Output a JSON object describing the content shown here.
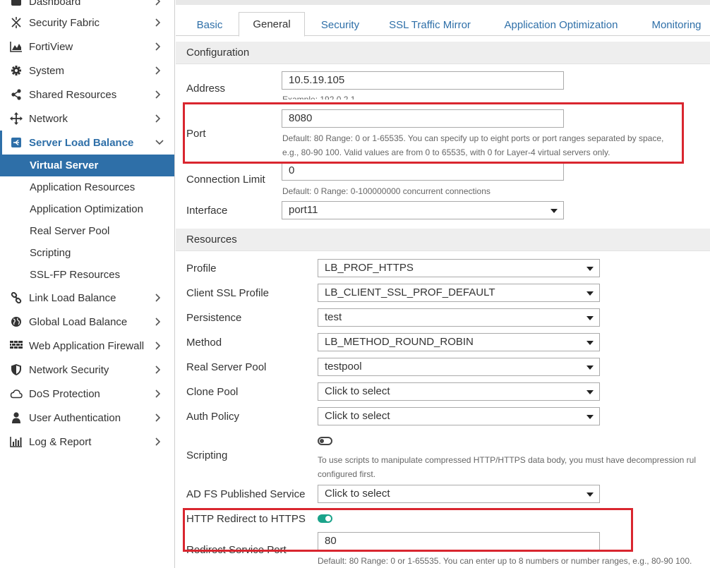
{
  "sidebar": {
    "items": [
      {
        "label": "Dashboard"
      },
      {
        "label": "Security Fabric"
      },
      {
        "label": "FortiView"
      },
      {
        "label": "System"
      },
      {
        "label": "Shared Resources"
      },
      {
        "label": "Network"
      },
      {
        "label": "Server Load Balance"
      },
      {
        "label": "Link Load Balance"
      },
      {
        "label": "Global Load Balance"
      },
      {
        "label": "Web Application Firewall"
      },
      {
        "label": "Network Security"
      },
      {
        "label": "DoS Protection"
      },
      {
        "label": "User Authentication"
      },
      {
        "label": "Log & Report"
      }
    ],
    "sub_items": [
      {
        "label": "Virtual Server"
      },
      {
        "label": "Application Resources"
      },
      {
        "label": "Application Optimization"
      },
      {
        "label": "Real Server Pool"
      },
      {
        "label": "Scripting"
      },
      {
        "label": "SSL-FP Resources"
      }
    ],
    "accent_color": "#2e6fa8"
  },
  "tabs": [
    {
      "label": "Basic"
    },
    {
      "label": "General"
    },
    {
      "label": "Security"
    },
    {
      "label": "SSL Traffic Mirror"
    },
    {
      "label": "Application Optimization"
    },
    {
      "label": "Monitoring"
    }
  ],
  "configuration": {
    "title": "Configuration",
    "address": {
      "label": "Address",
      "value": "10.5.19.105",
      "hint": "Example: 192.0.2.1"
    },
    "port": {
      "label": "Port",
      "value": "8080",
      "hint_line1": "Default: 80 Range: 0 or 1-65535. You can specify up to eight ports or port ranges separated by space,",
      "hint_line2": "e.g., 80-90 100. Valid values are from 0 to 65535, with 0 for Layer-4 virtual servers only."
    },
    "connection_limit": {
      "label": "Connection Limit",
      "value": "0",
      "hint": "Default: 0 Range: 0-100000000 concurrent connections"
    },
    "interface": {
      "label": "Interface",
      "value": "port11"
    }
  },
  "resources": {
    "title": "Resources",
    "profile": {
      "label": "Profile",
      "value": "LB_PROF_HTTPS"
    },
    "client_ssl_profile": {
      "label": "Client SSL Profile",
      "value": "LB_CLIENT_SSL_PROF_DEFAULT"
    },
    "persistence": {
      "label": "Persistence",
      "value": "test"
    },
    "method": {
      "label": "Method",
      "value": "LB_METHOD_ROUND_ROBIN"
    },
    "real_server_pool": {
      "label": "Real Server Pool",
      "value": "testpool"
    },
    "clone_pool": {
      "label": "Clone Pool",
      "value": "Click to select"
    },
    "auth_policy": {
      "label": "Auth Policy",
      "value": "Click to select"
    },
    "scripting": {
      "label": "Scripting",
      "enabled": false,
      "hint_line1": "To use scripts to manipulate compressed HTTP/HTTPS data body, you must have decompression rul",
      "hint_line2": "configured first."
    },
    "adfs": {
      "label": "AD FS Published Service",
      "value": "Click to select"
    },
    "http_redirect": {
      "label": "HTTP Redirect to HTTPS",
      "enabled": true
    },
    "redirect_port": {
      "label": "Redirect Service Port",
      "value": "80",
      "hint": "Default: 80 Range: 0 or 1-65535. You can enter up to 8 numbers or number ranges, e.g., 80-90 100."
    }
  },
  "colors": {
    "highlight_box": "#d9262f",
    "toggle_on": "#1aa38a"
  }
}
